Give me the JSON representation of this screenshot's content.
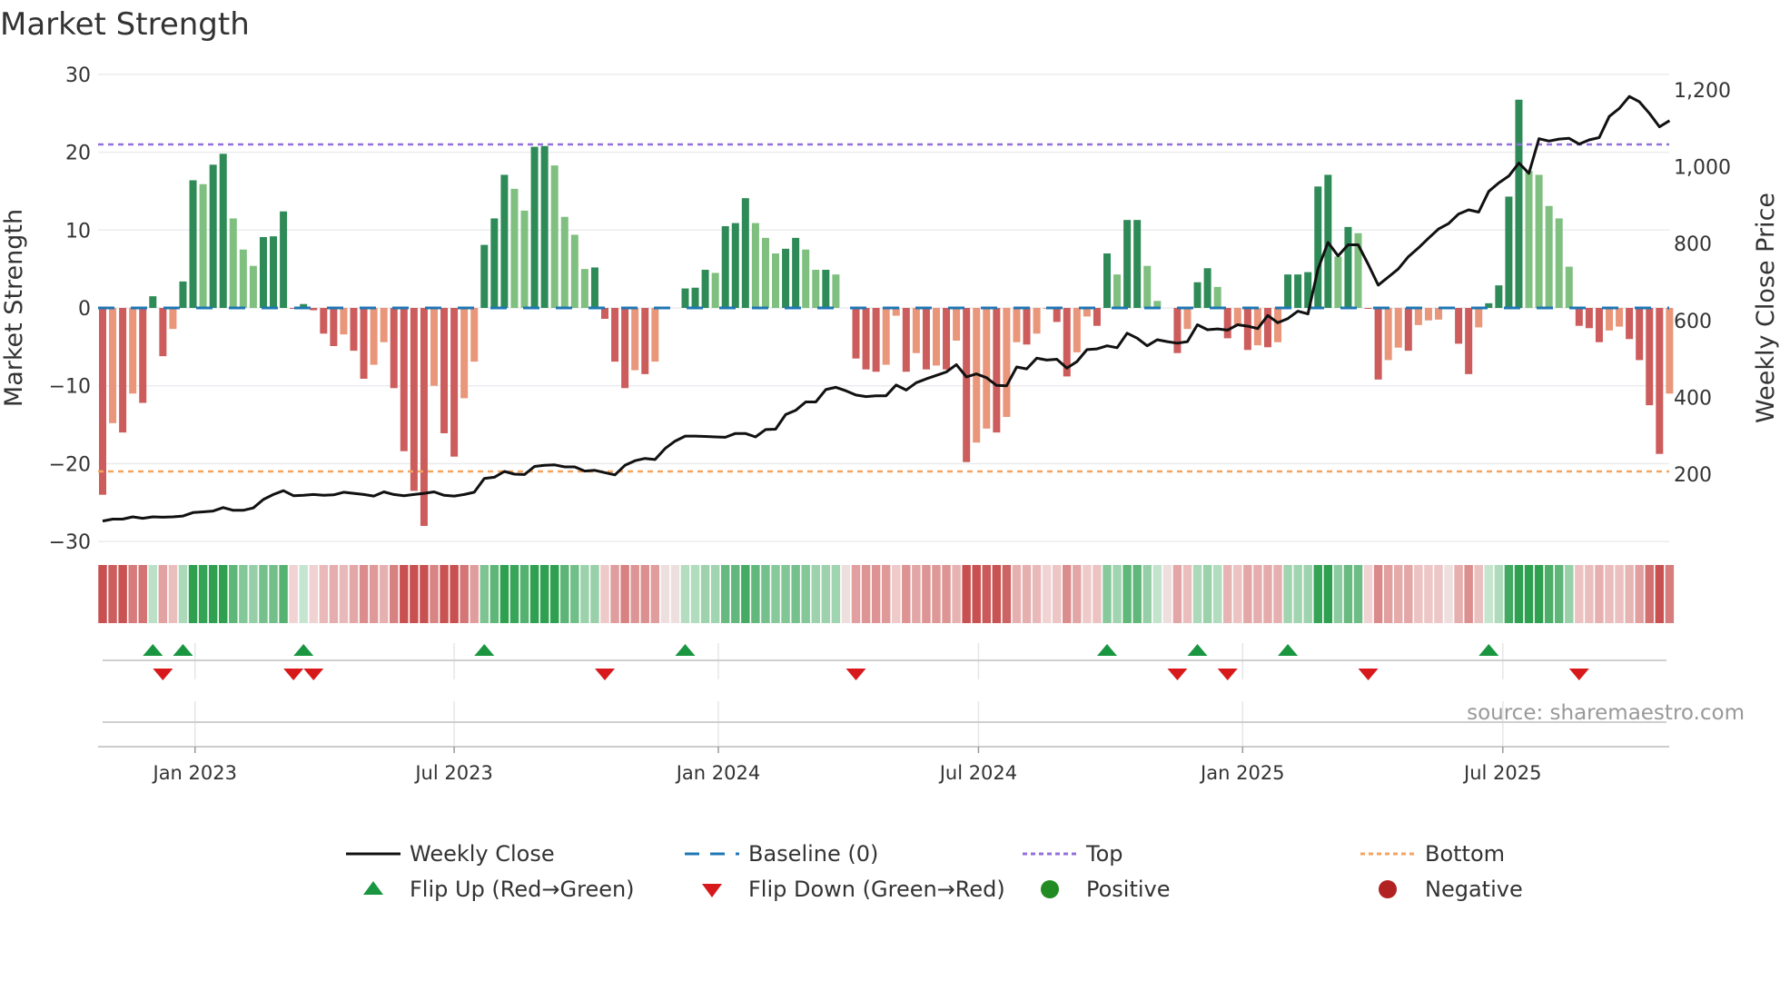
{
  "chart_data": {
    "type": "bar",
    "title": "Market Strength",
    "ylabel": "Market Strength",
    "y2label": "Weekly Close Price",
    "ylim": [
      -30,
      30
    ],
    "y2lim": [
      200,
      1200
    ],
    "yticks": [
      "30",
      "20",
      "10",
      "0",
      "−10",
      "−20",
      "−30"
    ],
    "ytick_values": [
      30,
      20,
      10,
      0,
      -10,
      -20,
      -30
    ],
    "y2ticks": [
      "200",
      "400",
      "600",
      "800",
      "1,000",
      "1,200"
    ],
    "y2tick_values": [
      200,
      400,
      600,
      800,
      1000,
      1200
    ],
    "xticks": [
      {
        "label": "Jan 2023",
        "week": 9.2
      },
      {
        "label": "Jul 2023",
        "week": 35
      },
      {
        "label": "Jan 2024",
        "week": 61.3
      },
      {
        "label": "Jul 2024",
        "week": 87.2
      },
      {
        "label": "Jan 2025",
        "week": 113.5
      },
      {
        "label": "Jul 2025",
        "week": 139.4
      }
    ],
    "top_level": 21,
    "bottom_level": -21,
    "strength": [
      -24,
      -14.8,
      -16,
      -11,
      -12.2,
      1.5,
      -6.2,
      -2.7,
      3.4,
      16.4,
      15.9,
      18.4,
      19.8,
      11.5,
      7.5,
      5.4,
      9.1,
      9.2,
      12.4,
      -0.1,
      0.5,
      -0.3,
      -3.3,
      -4.9,
      -3.4,
      -5.5,
      -9.1,
      -7.3,
      -4.4,
      -10.3,
      -18.4,
      -23.5,
      -28,
      -10,
      -16.1,
      -19.1,
      -11.6,
      -6.9,
      8.1,
      11.5,
      17.1,
      15.3,
      12.5,
      20.7,
      20.8,
      18.3,
      11.7,
      9.4,
      5,
      5.2,
      -1.4,
      -6.9,
      -10.3,
      -8,
      -8.5,
      -6.9,
      0,
      0,
      2.5,
      2.6,
      4.9,
      4.5,
      10.5,
      10.9,
      14.1,
      10.9,
      9,
      7,
      7.6,
      9,
      7.5,
      4.9,
      4.9,
      4.3,
      0,
      -6.5,
      -7.9,
      -8.2,
      -7.3,
      -1,
      -8.2,
      -5.8,
      -7.9,
      -7.4,
      -7.9,
      -4.2,
      -19.8,
      -17.3,
      -15.5,
      -16,
      -14,
      -4.4,
      -4.7,
      -3.3,
      -0.1,
      -1.8,
      -8.8,
      -5.7,
      -1.1,
      -2.3,
      7,
      4.3,
      11.3,
      11.3,
      5.4,
      0.9,
      0,
      -5.8,
      -2.7,
      3.3,
      5.1,
      2.7,
      -3.9,
      -2.2,
      -5.4,
      -4.8,
      -5.05,
      -4.4,
      4.3,
      4.3,
      4.6,
      15.6,
      17.1,
      6.6,
      10.4,
      9.6,
      -0.1,
      -9.2,
      -6.7,
      -5.1,
      -5.5,
      -2.2,
      -1.6,
      -1.5,
      0,
      -4.6,
      -8.5,
      -2.5,
      0.6,
      2.9,
      14.3,
      26.75,
      17.6,
      17.1,
      13.1,
      11.5,
      5.3,
      -2.3,
      -2.6,
      -4.4,
      -2.9,
      -2.4,
      -4,
      -6.7,
      -12.5,
      -18.75,
      -11
    ],
    "weekly_close": [
      78,
      83,
      83,
      89,
      85,
      89,
      88,
      89,
      91,
      100,
      102,
      104,
      113,
      106,
      106,
      112,
      134,
      147,
      157,
      144,
      145,
      147,
      145,
      146,
      153,
      150,
      147,
      143,
      154,
      147,
      144,
      147,
      150,
      154,
      145,
      143,
      147,
      153,
      189,
      192,
      207,
      200,
      199,
      220,
      223,
      224,
      219,
      219,
      208,
      210,
      204,
      198,
      223,
      235,
      241,
      238,
      267,
      286,
      299,
      299,
      298,
      297,
      296,
      306,
      306,
      297,
      316,
      317,
      355,
      366,
      388,
      388,
      420,
      426,
      417,
      406,
      402,
      404,
      404,
      432,
      419,
      438,
      448,
      457,
      466,
      485,
      453,
      461,
      451,
      431,
      430,
      479,
      474,
      502,
      497,
      499,
      476,
      493,
      524,
      526,
      534,
      529,
      567,
      554,
      534,
      550,
      545,
      541,
      545,
      589,
      576,
      578,
      575,
      589,
      585,
      579,
      613,
      594,
      605,
      624,
      617,
      734,
      803,
      768,
      797,
      797,
      746,
      692,
      713,
      734,
      766,
      789,
      814,
      838,
      852,
      877,
      888,
      882,
      936,
      958,
      976,
      1010,
      983,
      1073,
      1067,
      1072,
      1074,
      1059,
      1070,
      1076,
      1131,
      1152,
      1183,
      1169,
      1139,
      1104,
      1120
    ],
    "flip_up_weeks": [
      5,
      8,
      20,
      38,
      58,
      100,
      109,
      118,
      138
    ],
    "flip_down_weeks": [
      6,
      19,
      21,
      50,
      75,
      107,
      112,
      126,
      147
    ],
    "legend": [
      {
        "label": "Weekly Close",
        "kind": "line"
      },
      {
        "label": "Baseline (0)",
        "kind": "dash"
      },
      {
        "label": "Top",
        "kind": "dot-top"
      },
      {
        "label": "Bottom",
        "kind": "dot-bottom"
      },
      {
        "label": "Flip Up (Red→Green)",
        "kind": "tri-up"
      },
      {
        "label": "Flip Down (Green→Red)",
        "kind": "tri-down"
      },
      {
        "label": "Positive",
        "kind": "circle-pos"
      },
      {
        "label": "Negative",
        "kind": "circle-neg"
      }
    ],
    "legend_placement": "bottom",
    "source": "source: sharemaestro.com"
  },
  "colors": {
    "pos_strong": "#2e8b57",
    "pos_weak": "#7fbf7f",
    "neg_strong": "#cd5c5c",
    "neg_weak": "#e9967a",
    "line": "#111111",
    "baseline": "#1f77b4",
    "top": "#9370db",
    "bottom": "#f4a460",
    "flip_up": "#1a9641",
    "flip_down": "#d7191c",
    "positive": "#228b22",
    "negative": "#b22222"
  }
}
